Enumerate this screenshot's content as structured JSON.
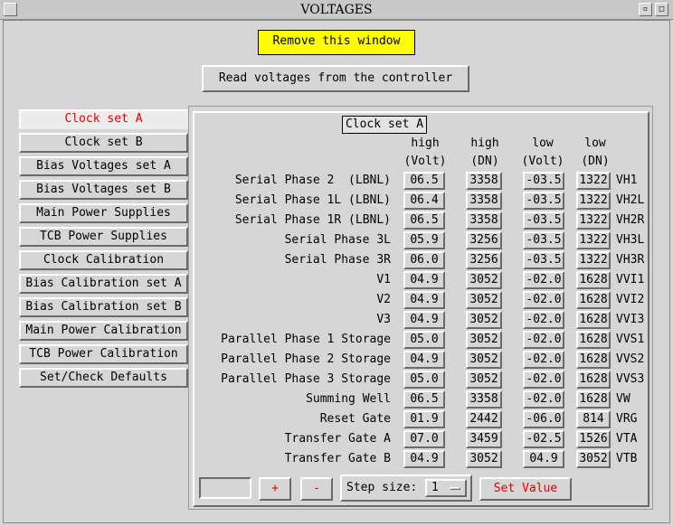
{
  "window": {
    "title": "VOLTAGES"
  },
  "toolbar": {
    "remove_label": "Remove this window",
    "read_label": "Read voltages from the controller"
  },
  "nav": {
    "items": [
      {
        "label": "Clock set A",
        "active": true
      },
      {
        "label": "Clock set B"
      },
      {
        "label": "Bias Voltages set A"
      },
      {
        "label": "Bias Voltages set B"
      },
      {
        "label": "Main Power Supplies"
      },
      {
        "label": "TCB Power Supplies"
      },
      {
        "label": "Clock Calibration"
      },
      {
        "label": "Bias Calibration set A"
      },
      {
        "label": "Bias Calibration set B"
      },
      {
        "label": "Main Power Calibration"
      },
      {
        "label": "TCB Power Calibration"
      },
      {
        "label": "Set/Check Defaults"
      }
    ]
  },
  "panel": {
    "title": "Clock set A",
    "headers": [
      {
        "top": "high",
        "bottom": "(Volt)"
      },
      {
        "top": "high",
        "bottom": "(DN)"
      },
      {
        "top": "low",
        "bottom": "(Volt)"
      },
      {
        "top": "low",
        "bottom": "(DN)"
      }
    ],
    "rows": [
      {
        "label": "Serial Phase 2  (LBNL)",
        "hv": "06.5",
        "hd": "3358",
        "lv": "-03.5",
        "ld": "1322",
        "suffix": "VH1"
      },
      {
        "label": "Serial Phase 1L (LBNL)",
        "hv": "06.4",
        "hd": "3358",
        "lv": "-03.5",
        "ld": "1322",
        "suffix": "VH2L"
      },
      {
        "label": "Serial Phase 1R (LBNL)",
        "hv": "06.5",
        "hd": "3358",
        "lv": "-03.5",
        "ld": "1322",
        "suffix": "VH2R"
      },
      {
        "label": "Serial Phase 3L",
        "hv": "05.9",
        "hd": "3256",
        "lv": "-03.5",
        "ld": "1322",
        "suffix": "VH3L"
      },
      {
        "label": "Serial Phase 3R",
        "hv": "06.0",
        "hd": "3256",
        "lv": "-03.5",
        "ld": "1322",
        "suffix": "VH3R"
      },
      {
        "label": "V1",
        "hv": "04.9",
        "hd": "3052",
        "lv": "-02.0",
        "ld": "1628",
        "suffix": "VVI1"
      },
      {
        "label": "V2",
        "hv": "04.9",
        "hd": "3052",
        "lv": "-02.0",
        "ld": "1628",
        "suffix": "VVI2"
      },
      {
        "label": "V3",
        "hv": "04.9",
        "hd": "3052",
        "lv": "-02.0",
        "ld": "1628",
        "suffix": "VVI3"
      },
      {
        "label": "Parallel Phase 1 Storage",
        "hv": "05.0",
        "hd": "3052",
        "lv": "-02.0",
        "ld": "1628",
        "suffix": "VVS1"
      },
      {
        "label": "Parallel Phase 2 Storage",
        "hv": "04.9",
        "hd": "3052",
        "lv": "-02.0",
        "ld": "1628",
        "suffix": "VVS2"
      },
      {
        "label": "Parallel Phase 3 Storage",
        "hv": "05.0",
        "hd": "3052",
        "lv": "-02.0",
        "ld": "1628",
        "suffix": "VVS3"
      },
      {
        "label": "Summing Well",
        "hv": "06.5",
        "hd": "3358",
        "lv": "-02.0",
        "ld": "1628",
        "suffix": "VW"
      },
      {
        "label": "Reset Gate",
        "hv": "01.9",
        "hd": "2442",
        "lv": "-06.0",
        "ld": "814",
        "suffix": "VRG"
      },
      {
        "label": "Transfer Gate A",
        "hv": "07.0",
        "hd": "3459",
        "lv": "-02.5",
        "ld": "1526",
        "suffix": "VTA"
      },
      {
        "label": "Transfer Gate B",
        "hv": "04.9",
        "hd": "3052",
        "lv": "04.9",
        "ld": "3052",
        "suffix": "VTB"
      }
    ]
  },
  "controls": {
    "value": "",
    "plus_label": "+",
    "minus_label": "-",
    "step_label": "Step size:",
    "step_value": "1",
    "set_value_label": "Set Value"
  },
  "colors": {
    "accent_red": "#e00000",
    "yellow": "#ffff00"
  }
}
